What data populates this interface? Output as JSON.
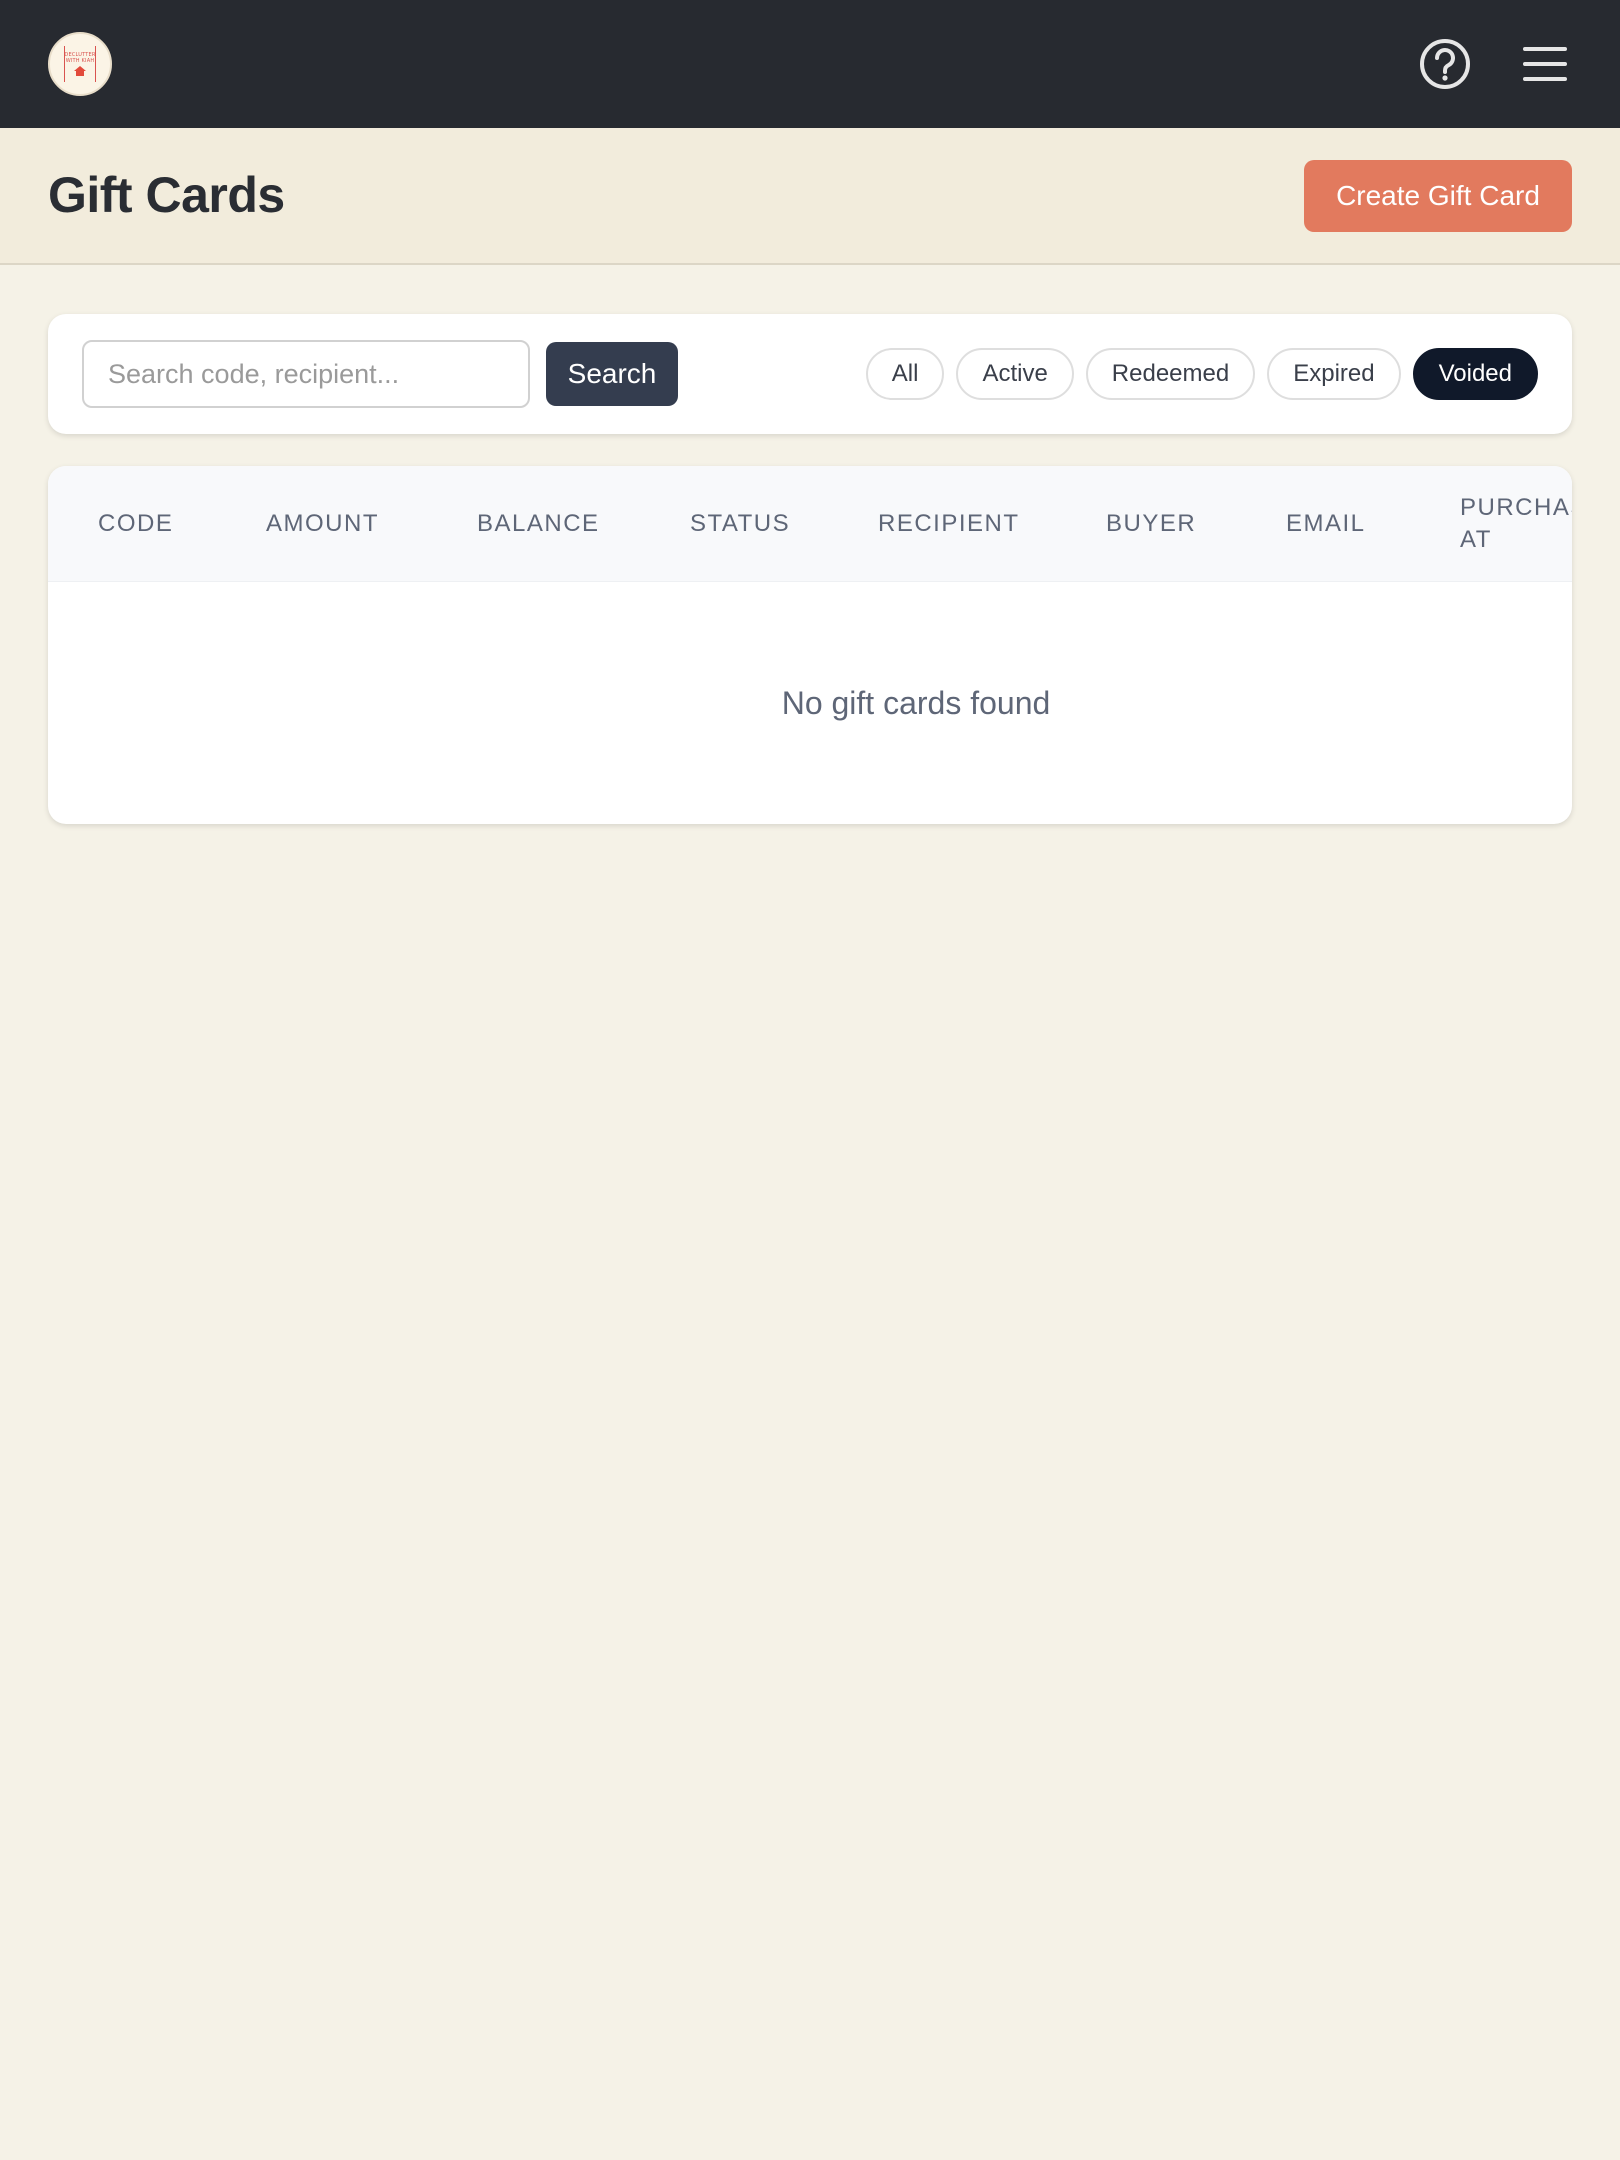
{
  "topbar": {
    "logo_text": "DECLUTTER WITH KIAH",
    "icons": [
      "help-circle-icon",
      "hamburger-menu-icon"
    ]
  },
  "header": {
    "title": "Gift Cards",
    "create_label": "Create Gift Card"
  },
  "filters": {
    "search_placeholder": "Search code, recipient...",
    "search_label": "Search",
    "chips": [
      {
        "label": "All",
        "active": false
      },
      {
        "label": "Active",
        "active": false
      },
      {
        "label": "Redeemed",
        "active": false
      },
      {
        "label": "Expired",
        "active": false
      },
      {
        "label": "Voided",
        "active": true
      }
    ]
  },
  "table": {
    "columns": [
      "CODE",
      "AMOUNT",
      "BALANCE",
      "STATUS",
      "RECIPIENT",
      "BUYER",
      "EMAIL",
      "PURCHASED AT"
    ],
    "empty_message": "No gift cards found"
  },
  "colors": {
    "topbar": "#272a30",
    "accent": "#e27a5e",
    "search_button": "#343d4f",
    "active_chip": "#10192a",
    "background": "#f5f2e7"
  }
}
